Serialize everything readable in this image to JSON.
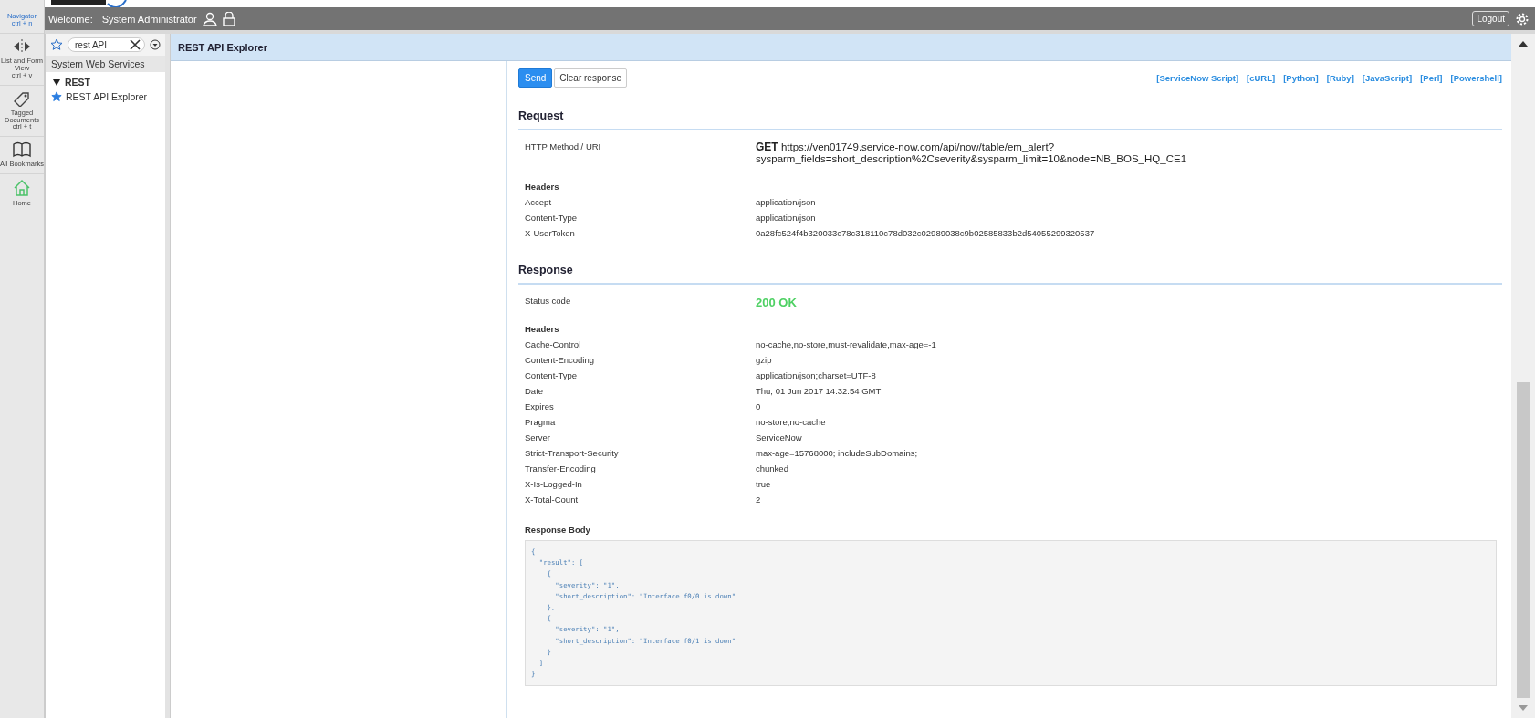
{
  "rail": [
    {
      "kind": "navigator",
      "label": "Navigator",
      "shortcut": "ctrl + n"
    },
    {
      "kind": "listform",
      "label": "List and Form View",
      "shortcut": "ctrl + v"
    },
    {
      "kind": "tag",
      "label": "Tagged Documents",
      "shortcut": "ctrl + t"
    },
    {
      "kind": "book",
      "label": "All Bookmarks"
    },
    {
      "kind": "home",
      "label": "Home"
    }
  ],
  "header": {
    "welcome": "Welcome:",
    "user": "System Administrator",
    "logout": "Logout"
  },
  "navigator": {
    "filter": "rest API",
    "group": "System Web Services",
    "section": {
      "label": "REST",
      "expanded": true,
      "children": [
        {
          "label": "REST API Explorer",
          "favorite": true
        }
      ]
    }
  },
  "page": {
    "title": "REST API Explorer",
    "buttons": [
      {
        "label": "Send",
        "primary": true
      },
      {
        "label": "Clear response",
        "primary": false
      }
    ],
    "code_links": [
      "[ServiceNow Script]",
      "[cURL]",
      "[Python]",
      "[Ruby]",
      "[JavaScript]",
      "[Perl]",
      "[Powershell]"
    ],
    "request": {
      "title": "Request",
      "method_label": "HTTP Method / URI",
      "method": "GET",
      "uri_lines": [
        "https://ven01749.service-now.com/api/now/table/em_alert?",
        "sysparm_fields=short_description%2Cseverity&sysparm_limit=10&node=NB_BOS_HQ_CE1"
      ],
      "headers_title": "Headers",
      "headers": [
        {
          "name": "Accept",
          "value": "application/json"
        },
        {
          "name": "Content-Type",
          "value": "application/json"
        },
        {
          "name": "X-UserToken",
          "value": "0a28fc524f4b320033c78c318110c78d032c02989038c9b02585833b2d54055299320537"
        }
      ]
    },
    "response": {
      "title": "Response",
      "status_label": "Status code",
      "status": "200 OK",
      "headers_title": "Headers",
      "headers": [
        {
          "name": "Cache-Control",
          "value": "no-cache,no-store,must-revalidate,max-age=-1"
        },
        {
          "name": "Content-Encoding",
          "value": "gzip"
        },
        {
          "name": "Content-Type",
          "value": "application/json;charset=UTF-8"
        },
        {
          "name": "Date",
          "value": "Thu, 01 Jun 2017 14:32:54 GMT"
        },
        {
          "name": "Expires",
          "value": "0"
        },
        {
          "name": "Pragma",
          "value": "no-store,no-cache"
        },
        {
          "name": "Server",
          "value": "ServiceNow"
        },
        {
          "name": "Strict-Transport-Security",
          "value": "max-age=15768000; includeSubDomains;"
        },
        {
          "name": "Transfer-Encoding",
          "value": "chunked"
        },
        {
          "name": "X-Is-Logged-In",
          "value": "true"
        },
        {
          "name": "X-Total-Count",
          "value": "2"
        }
      ],
      "body_title": "Response Body",
      "body": "{\n  \"result\": [\n    {\n      \"severity\": \"1\",\n      \"short_description\": \"Interface f0/0 is down\"\n    },\n    {\n      \"severity\": \"1\",\n      \"short_description\": \"Interface f0/1 is down\"\n    }\n  ]\n}"
    }
  }
}
